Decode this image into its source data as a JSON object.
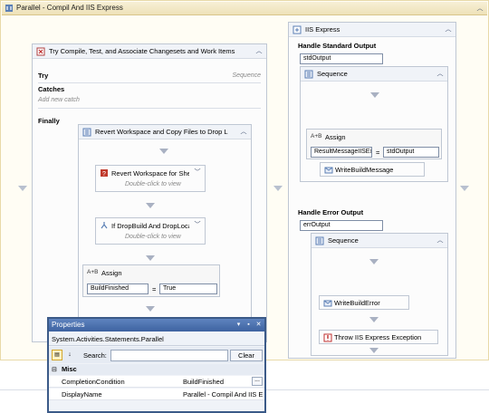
{
  "parallel": {
    "title": "Parallel - Compil And IIS Express"
  },
  "try_pane": {
    "title": "Try Compile, Test, and Associate Changesets and Work Items",
    "try_label": "Try",
    "try_value": "Sequence",
    "catches_label": "Catches",
    "add_catch": "Add new catch",
    "finally_label": "Finally",
    "revert_copy": {
      "title": "Revert Workspace and Copy Files to Drop L",
      "revert_shelveset": {
        "title": "Revert Workspace for Shelves",
        "hint": "Double-click to view"
      },
      "if_dropbuild": {
        "title": "If DropBuild And DropLocatio",
        "hint": "Double-click to view"
      },
      "assign": {
        "icon_text": "A+B",
        "title": "Assign",
        "to": "BuildFinished",
        "eq": "=",
        "value": "True"
      }
    }
  },
  "iis_pane": {
    "title": "IIS Express",
    "std_heading": "Handle Standard Output",
    "std_var": "stdOutput",
    "std_seq": {
      "title": "Sequence",
      "assign": {
        "icon_text": "A+B",
        "title": "Assign",
        "to": "ResultMessageIISExp",
        "eq": "=",
        "value": "stdOutput"
      },
      "write_msg": "WriteBuildMessage"
    },
    "err_heading": "Handle Error Output",
    "err_var": "errOutput",
    "err_seq": {
      "title": "Sequence",
      "write_err": "WriteBuildError",
      "throw": "Throw IIS Express Exception"
    }
  },
  "properties": {
    "title": "Properties",
    "subject": "System.Activities.Statements.Parallel",
    "search_label": "Search:",
    "search_value": "",
    "clear_label": "Clear",
    "category": "Misc",
    "rows": [
      {
        "name": "CompletionCondition",
        "value": "BuildFinished",
        "button": "..."
      },
      {
        "name": "DisplayName",
        "value": "Parallel - Compil And IIS E"
      }
    ]
  }
}
